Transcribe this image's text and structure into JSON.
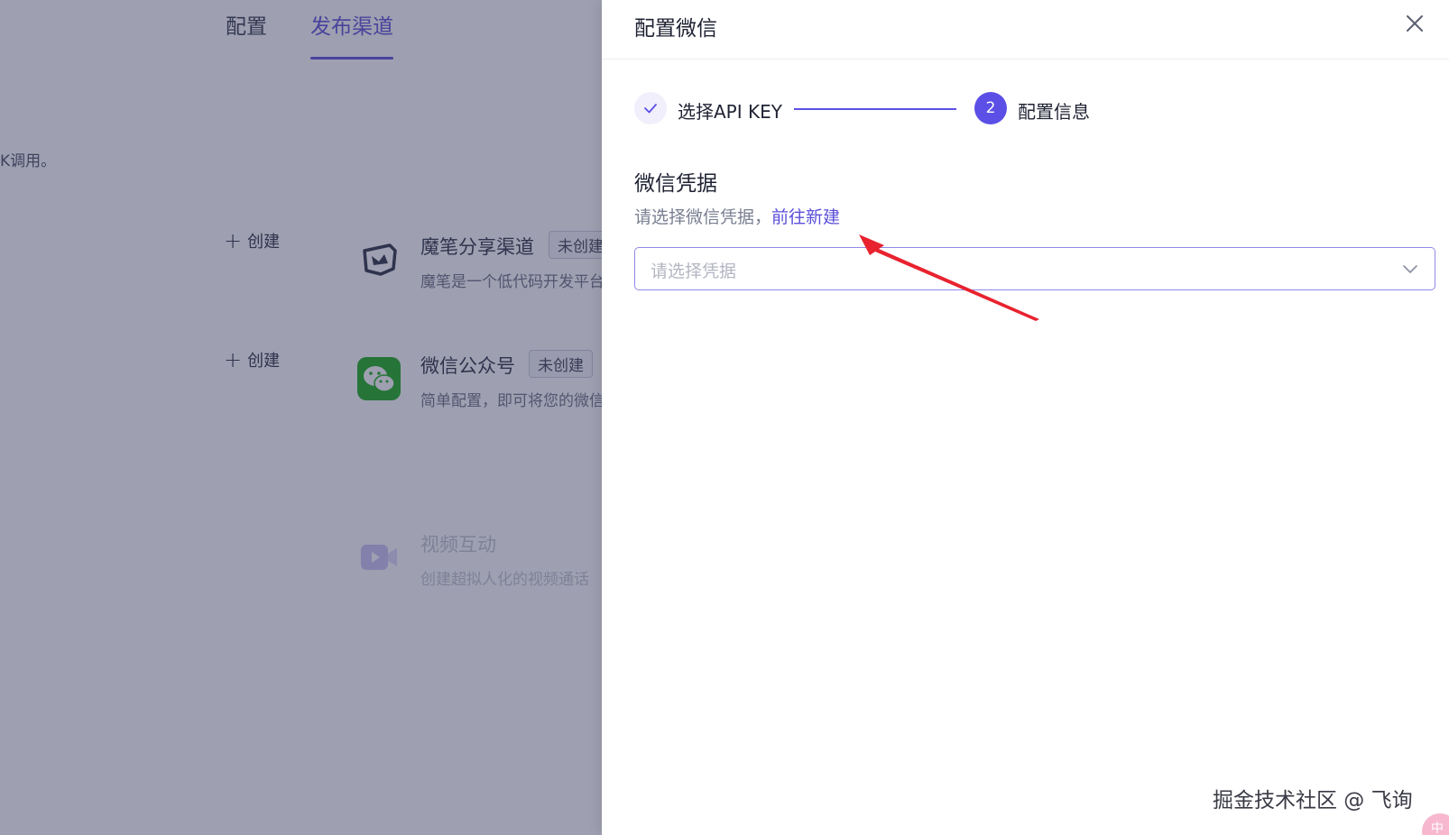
{
  "background": {
    "tabs": [
      {
        "label": "配置",
        "active": false
      },
      {
        "label": "发布渠道",
        "active": true
      }
    ],
    "description_fragment": "K调用。",
    "create_label": "创建",
    "cards": [
      {
        "icon": "mobi-pen-icon",
        "title": "魔笔分享渠道",
        "badge": "未创建",
        "desc": "魔笔是一个低代码开发平台"
      },
      {
        "icon": "wechat-icon",
        "title": "微信公众号",
        "badge": "未创建",
        "desc": "简单配置，即可将您的微信"
      },
      {
        "icon": "video-icon",
        "title": "视频互动",
        "badge": "",
        "desc": "创建超拟人化的视频通话"
      }
    ]
  },
  "drawer": {
    "title": "配置微信",
    "steps": [
      {
        "number": "",
        "label": "选择API KEY",
        "status": "done"
      },
      {
        "number": "2",
        "label": "配置信息",
        "status": "active"
      }
    ],
    "section_title": "微信凭据",
    "hint_text": "请选择微信凭据，",
    "hint_link": "前往新建",
    "select_placeholder": "请选择凭据"
  },
  "watermark": "掘金技术社区 @ 飞询",
  "corner_badge": "中",
  "colors": {
    "accent": "#5b4fe6",
    "arrow": "#e8232f",
    "overlay": "rgba(52,54,90,0.48)",
    "wechat_green": "#1aad19"
  }
}
